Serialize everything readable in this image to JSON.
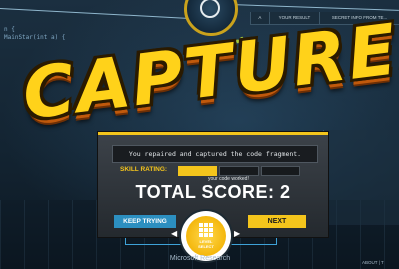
{
  "background": {
    "code_lines": [
      "n {",
      "MainStar(int a) {"
    ],
    "tabs": [
      "A",
      "YOUR RESULT",
      "SECRET INFO FROM TE..."
    ]
  },
  "title": "CAPTURED!",
  "dialog": {
    "message": "You repaired and captured the code fragment.",
    "skill_label": "SKILL RATING:",
    "skill_rating": {
      "filled": 1,
      "total": 3
    },
    "worked_text": "your code worked!",
    "score_text": "TOTAL SCORE: 2",
    "keep_trying_label": "KEEP TRYING",
    "next_label": "NEXT"
  },
  "level_select": {
    "label_line1": "LEVEL",
    "label_line2": "SELECT",
    "icon": "grid-icon"
  },
  "footer": {
    "brand": "Microsoft Research",
    "right_text": "ABOUT | T"
  },
  "colors": {
    "accent_yellow": "#f4c51c",
    "accent_blue": "#2c8fc0",
    "title_fill": "#ffd21a"
  }
}
